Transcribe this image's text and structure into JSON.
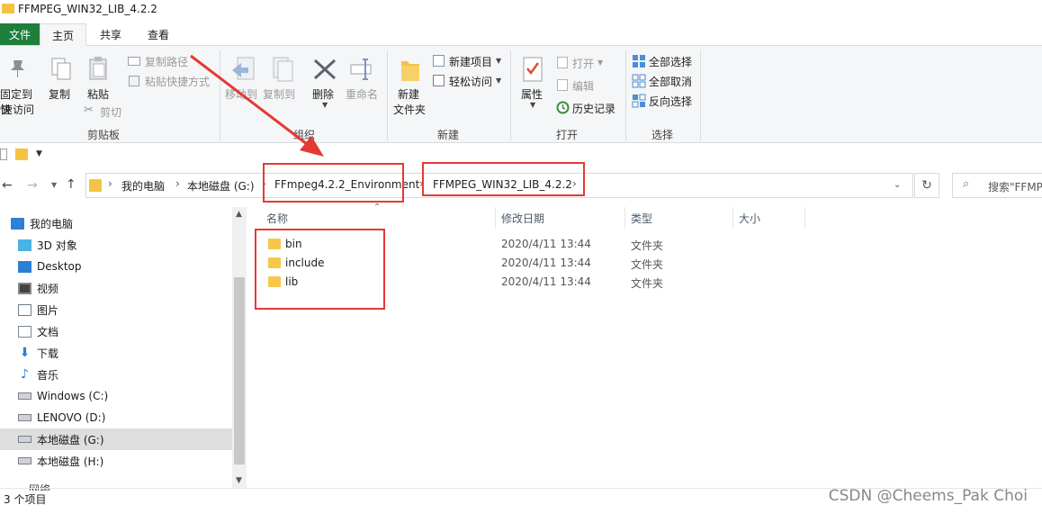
{
  "window": {
    "title": "FFMPEG_WIN32_LIB_4.2.2"
  },
  "tabs": {
    "file": "文件",
    "home": "主页",
    "share": "共享",
    "view": "查看"
  },
  "ribbon": {
    "clipboard": {
      "label": "剪贴板",
      "pin_line1": "固定到快",
      "pin_line2": "速访问",
      "copy": "复制",
      "paste": "粘贴",
      "copy_path": "复制路径",
      "paste_shortcut": "粘贴快捷方式",
      "cut": "剪切"
    },
    "organize": {
      "label": "组织",
      "move_to": "移动到",
      "copy_to": "复制到",
      "delete": "删除",
      "rename": "重命名"
    },
    "new": {
      "label": "新建",
      "new_folder_line1": "新建",
      "new_folder_line2": "文件夹",
      "new_item": "新建项目",
      "easy_access": "轻松访问"
    },
    "open": {
      "label": "打开",
      "properties": "属性",
      "open": "打开",
      "edit": "编辑",
      "history": "历史记录"
    },
    "select": {
      "label": "选择",
      "select_all": "全部选择",
      "select_none": "全部取消",
      "invert": "反向选择"
    }
  },
  "address": {
    "crumbs": [
      "我的电脑",
      "本地磁盘 (G:)",
      "FFmpeg4.2.2_Environment",
      "FFMPEG_WIN32_LIB_4.2.2"
    ],
    "search_placeholder": "搜索\"FFMP"
  },
  "nav": {
    "items": [
      {
        "label": "我的电脑",
        "icon": "computer-icon"
      },
      {
        "label": "3D 对象",
        "icon": "3d-objects-icon"
      },
      {
        "label": "Desktop",
        "icon": "desktop-icon"
      },
      {
        "label": "视频",
        "icon": "video-icon"
      },
      {
        "label": "图片",
        "icon": "pictures-icon"
      },
      {
        "label": "文档",
        "icon": "documents-icon"
      },
      {
        "label": "下载",
        "icon": "downloads-icon"
      },
      {
        "label": "音乐",
        "icon": "music-icon"
      },
      {
        "label": "Windows (C:)",
        "icon": "drive-icon"
      },
      {
        "label": "LENOVO (D:)",
        "icon": "drive-icon"
      },
      {
        "label": "本地磁盘 (G:)",
        "icon": "drive-icon",
        "selected": true
      },
      {
        "label": "本地磁盘 (H:)",
        "icon": "drive-icon"
      }
    ],
    "partial_item": "网络"
  },
  "columns": {
    "name": "名称",
    "modified": "修改日期",
    "type": "类型",
    "size": "大小"
  },
  "files": [
    {
      "name": "bin",
      "modified": "2020/4/11 13:44",
      "type": "文件夹"
    },
    {
      "name": "include",
      "modified": "2020/4/11 13:44",
      "type": "文件夹"
    },
    {
      "name": "lib",
      "modified": "2020/4/11 13:44",
      "type": "文件夹"
    }
  ],
  "status": {
    "count": "3 个项目"
  },
  "watermark": "CSDN @Cheems_Pak Choi",
  "colors": {
    "file_tab": "#1e7f3c",
    "folder": "#f6c74b",
    "annotation": "#e53935",
    "selection": "#dedede"
  }
}
